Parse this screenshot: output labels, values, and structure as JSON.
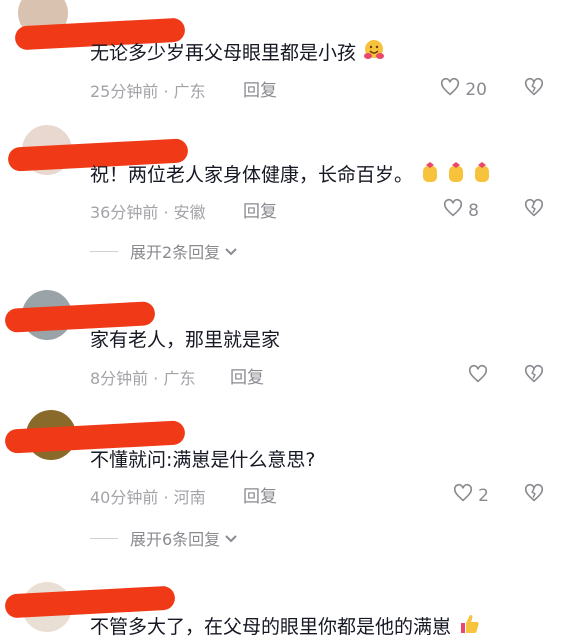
{
  "comments": [
    {
      "text": "无论多少岁再父母眼里都是小孩",
      "time": "25分钟前",
      "location": "广东",
      "reply_label": "回复",
      "likes": "20",
      "emoji": "hug-face-icon"
    },
    {
      "text": "祝！两位老人家身体健康，长命百岁。",
      "time": "36分钟前",
      "location": "安徽",
      "reply_label": "回复",
      "likes": "8",
      "emoji": "crossed-fingers-icon",
      "expand_label": "展开2条回复"
    },
    {
      "text": "家有老人，那里就是家",
      "time": "8分钟前",
      "location": "广东",
      "reply_label": "回复",
      "likes": ""
    },
    {
      "text": "不懂就问:满崽是什么意思?",
      "time": "40分钟前",
      "location": "河南",
      "reply_label": "回复",
      "likes": "2",
      "expand_label": "展开6条回复"
    },
    {
      "text": "不管多大了，在父母的眼里你都是他的满崽",
      "emoji": "thumbs-up-icon"
    }
  ],
  "separator": "·",
  "colors": {
    "redaction": "#f03a17",
    "meta": "#a3a3a8",
    "text": "#161823"
  }
}
